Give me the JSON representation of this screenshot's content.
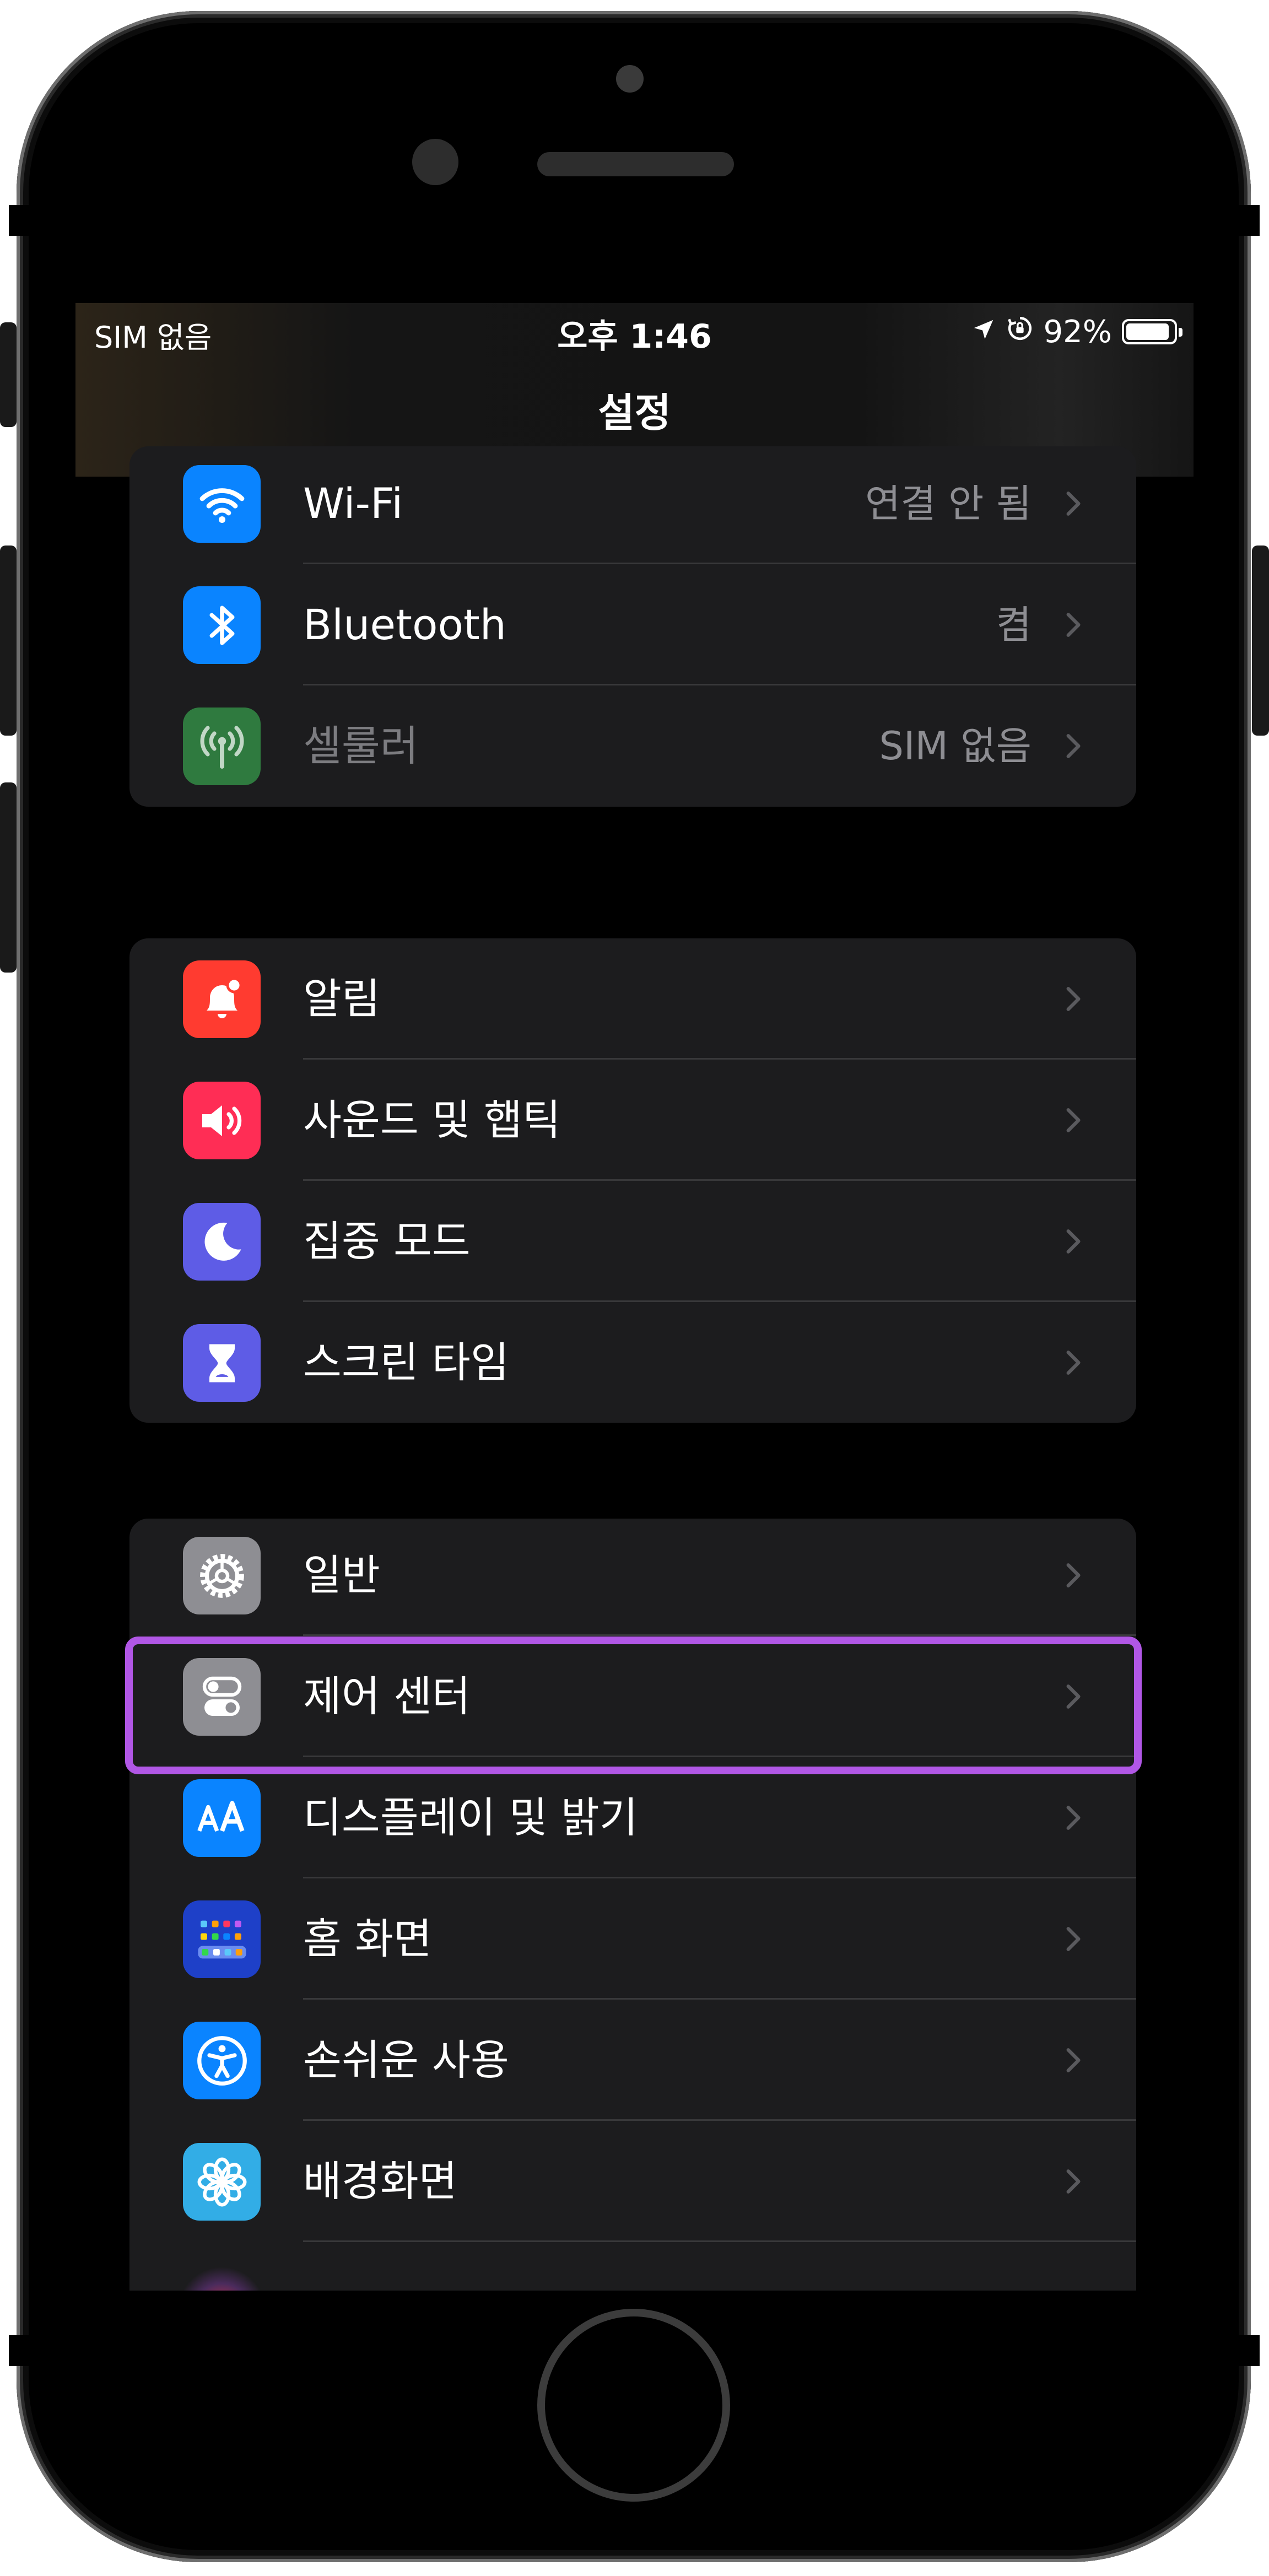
{
  "status_bar": {
    "carrier": "SIM 없음",
    "time": "오후 1:46",
    "battery_percent": "92%",
    "battery_level": 0.92,
    "icons": [
      "location-arrow-icon",
      "rotation-lock-icon",
      "battery-icon"
    ]
  },
  "nav": {
    "title": "설정"
  },
  "groups": [
    {
      "rows": [
        {
          "label": "Wi-Fi",
          "value": "연결 안 됨",
          "icon": "wifi-icon",
          "color": "#0a84ff"
        },
        {
          "label": "Bluetooth",
          "value": "켬",
          "icon": "bluetooth-icon",
          "color": "#0a84ff"
        },
        {
          "label": "셀룰러",
          "value": "SIM 없음",
          "icon": "cellular-antenna-icon",
          "color": "#2f7a3f",
          "dimmed": true
        }
      ]
    },
    {
      "rows": [
        {
          "label": "알림",
          "icon": "bell-icon",
          "color": "#ff3b30"
        },
        {
          "label": "사운드 및 햅틱",
          "icon": "speaker-icon",
          "color": "#ff2d55"
        },
        {
          "label": "집중 모드",
          "icon": "moon-icon",
          "color": "#5e5ce6"
        },
        {
          "label": "스크린 타임",
          "icon": "hourglass-icon",
          "color": "#5e5ce6"
        }
      ]
    },
    {
      "rows": [
        {
          "label": "일반",
          "icon": "gear-icon",
          "color": "#8e8e93"
        },
        {
          "label": "제어 센터",
          "icon": "toggles-icon",
          "color": "#8e8e93",
          "highlighted": true
        },
        {
          "label": "디스플레이 및 밝기",
          "icon": "text-size-aa-icon",
          "color": "#0a84ff"
        },
        {
          "label": "홈 화면",
          "icon": "home-screen-grid-icon",
          "color": "#1e40c8"
        },
        {
          "label": "손쉬운 사용",
          "icon": "accessibility-icon",
          "color": "#0a84ff"
        },
        {
          "label": "배경화면",
          "icon": "flower-icon",
          "color": "#32ade6"
        }
      ]
    }
  ]
}
